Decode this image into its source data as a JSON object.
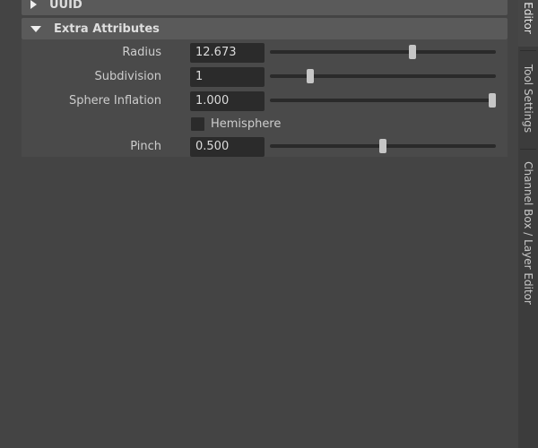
{
  "sections": {
    "uuid": {
      "label": "UUID",
      "expanded": false
    },
    "extra_attributes": {
      "label": "Extra Attributes",
      "expanded": true
    }
  },
  "attributes": {
    "radius": {
      "label": "Radius",
      "value": "12.673",
      "slider_fraction": 0.63
    },
    "subdivision": {
      "label": "Subdivision",
      "value": "1",
      "slider_fraction": 0.18
    },
    "sphere_inflation": {
      "label": "Sphere Inflation",
      "value": "1.000",
      "slider_fraction": 1.0
    },
    "hemisphere": {
      "label": "Hemisphere",
      "checked": false
    },
    "pinch": {
      "label": "Pinch",
      "value": "0.500",
      "slider_fraction": 0.5
    }
  },
  "side_tabs": [
    {
      "label": "Attribute Editor",
      "visible_text": "Editor",
      "active": true
    },
    {
      "label": "Tool Settings",
      "active": false
    },
    {
      "label": "Channel Box / Layer Editor",
      "active": false
    }
  ],
  "colors": {
    "background": "#444444",
    "section_header": "#5a5a5a",
    "field": "#2b2b2b",
    "slider_handle": "#c6c6c6"
  }
}
